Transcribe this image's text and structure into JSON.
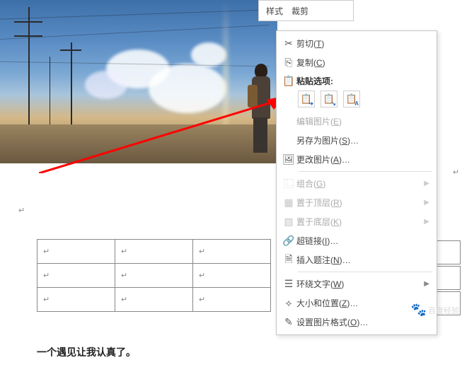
{
  "toolbar": {
    "style": "样式",
    "crop": "裁剪"
  },
  "context_menu": {
    "cut": "剪切(T)",
    "copy": "复制(C)",
    "paste_header": "粘贴选项:",
    "edit_picture": "编辑图片(E)",
    "save_as_picture": "另存为图片(S)…",
    "change_picture": "更改图片(A)…",
    "group": "组合(G)",
    "bring_front": "置于顶层(R)",
    "send_back": "置于底层(K)",
    "hyperlink": "超链接(I)…",
    "insert_caption": "插入题注(N)…",
    "wrap_text": "环绕文字(W)",
    "size_position": "大小和位置(Z)…",
    "format_picture": "设置图片格式(O)…"
  },
  "body_text": "一个遇见让我认真了。",
  "para_mark": "↵",
  "watermark": {
    "text": "百度经验"
  }
}
